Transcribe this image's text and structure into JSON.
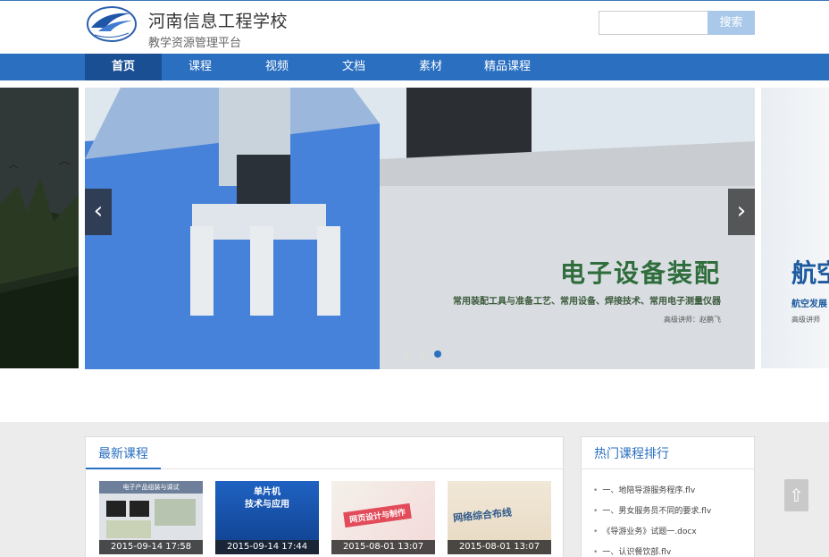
{
  "header": {
    "school_name": "河南信息工程学校",
    "platform_name": "教学资源管理平台",
    "logo_icon": "school-emblem-icon",
    "search": {
      "placeholder": "",
      "button_label": "搜索"
    }
  },
  "nav": {
    "items": [
      {
        "label": "首页",
        "active": true
      },
      {
        "label": "课程",
        "active": false
      },
      {
        "label": "视频",
        "active": false
      },
      {
        "label": "文档",
        "active": false
      },
      {
        "label": "素材",
        "active": false
      },
      {
        "label": "精品课程",
        "active": false
      }
    ]
  },
  "banner": {
    "main": {
      "title": "电子设备装配",
      "subtitle": "常用装配工具与准备工艺、常用设备、焊接技术、常用电子测量仪器",
      "teacher": "高级讲师：赵鹏飞"
    },
    "next_peek": {
      "title": "航空",
      "subtitle": "航空发展",
      "teacher": "高级讲师"
    },
    "prev_arrow": "‹",
    "next_arrow": "›",
    "dots": 3,
    "active_dot": 3
  },
  "latest_courses": {
    "title": "最新课程",
    "items": [
      {
        "caption": "电子产品组装与调试",
        "date": "2015-09-14 17:58"
      },
      {
        "caption": "单片机\n技术与应用",
        "date": "2015-09-14 17:44"
      },
      {
        "caption": "网页设计与制作",
        "date": "2015-08-01 13:07"
      },
      {
        "caption": "网络综合布线",
        "date": "2015-08-01 13:07"
      }
    ]
  },
  "hot_ranking": {
    "title": "热门课程排行",
    "items": [
      "一、地陪导游服务程序.flv",
      "一、男女服务员不同的要求.flv",
      "《导游业务》试题一.docx",
      "一、认识餐饮部.flv"
    ]
  },
  "back_to_top": "⇧",
  "colors": {
    "accent": "#2a6fc0",
    "nav_active": "#1a4f94",
    "search_button": "#a9c8ea"
  }
}
